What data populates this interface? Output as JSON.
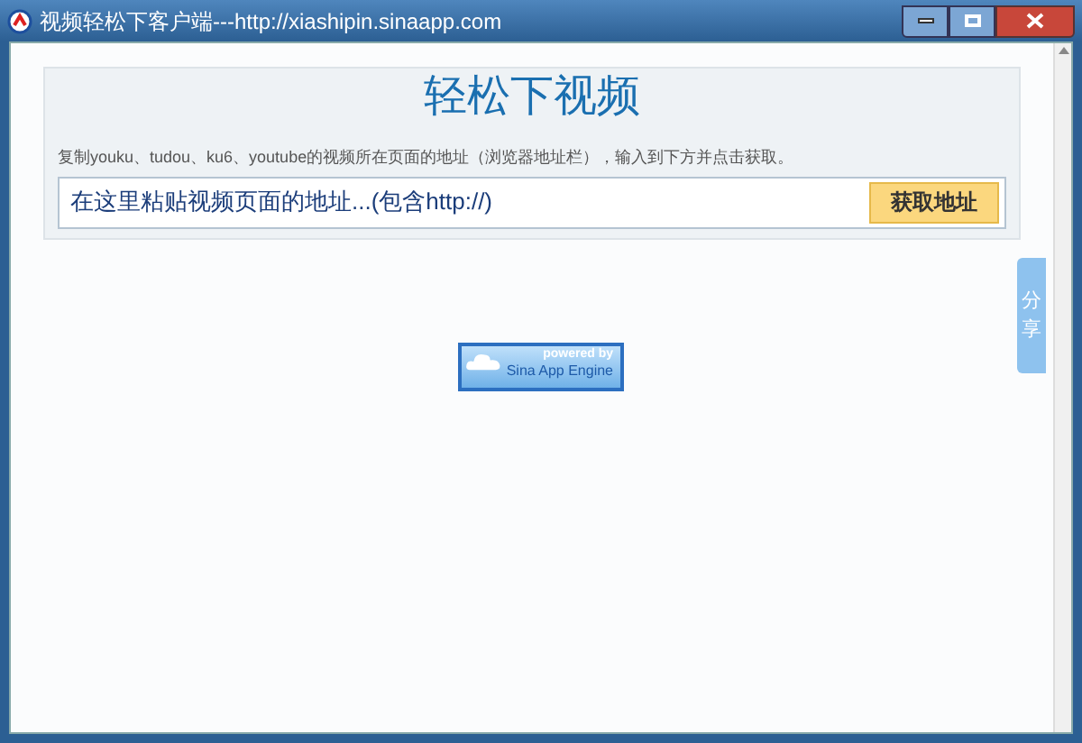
{
  "window": {
    "title": "视频轻松下客户端---http://xiashipin.sinaapp.com"
  },
  "header": {
    "title": "轻松下视频",
    "instructions": "复制youku、tudou、ku6、youtube的视频所在页面的地址（浏览器地址栏），输入到下方并点击获取。"
  },
  "url_field": {
    "placeholder": "在这里粘贴视频页面的地址...(包含http://)"
  },
  "fetch_button": {
    "label": "获取地址"
  },
  "powered_badge": {
    "powered_by": "powered by",
    "engine": "Sina App Engine"
  },
  "share_tab": {
    "label": "分享"
  }
}
